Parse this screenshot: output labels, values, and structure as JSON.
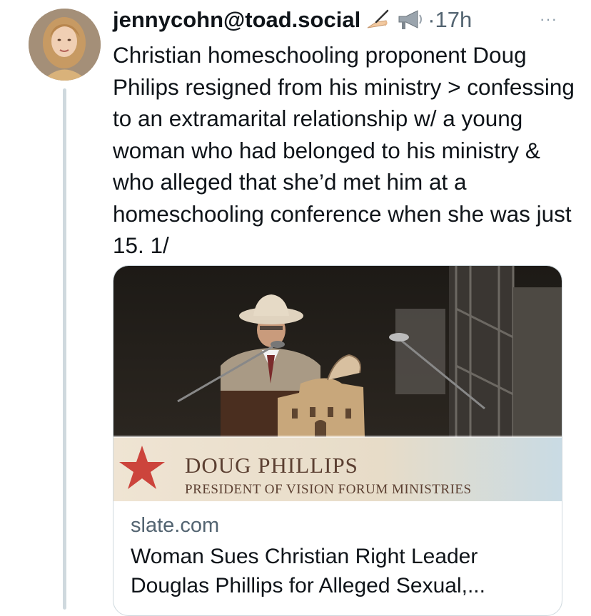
{
  "post": {
    "handle": "jennycohn@toad.social",
    "separator": "·",
    "time": "17h",
    "more_label": "···",
    "text": "Christian homeschooling proponent Doug Philips resigned from his ministry > confessing to an extramarital relationship w/ a young woman who had belonged to his ministry & who alleged that she’d met him at a homeschooling conference when she was just 15. 1/",
    "emojis": [
      "writing-hand-icon",
      "megaphone-icon"
    ]
  },
  "link_card": {
    "image_lower_third": {
      "name": "DOUG PHILLIPS",
      "subtitle": "PRESIDENT OF VISION FORUM MINISTRIES"
    },
    "domain": "slate.com",
    "title": "Woman Sues Christian Right Leader Douglas Phillips for Alleged Sexual,..."
  },
  "colors": {
    "text": "#0f1419",
    "secondary": "#536471",
    "border": "#cfd9de",
    "thread_line": "#cfd9de"
  }
}
